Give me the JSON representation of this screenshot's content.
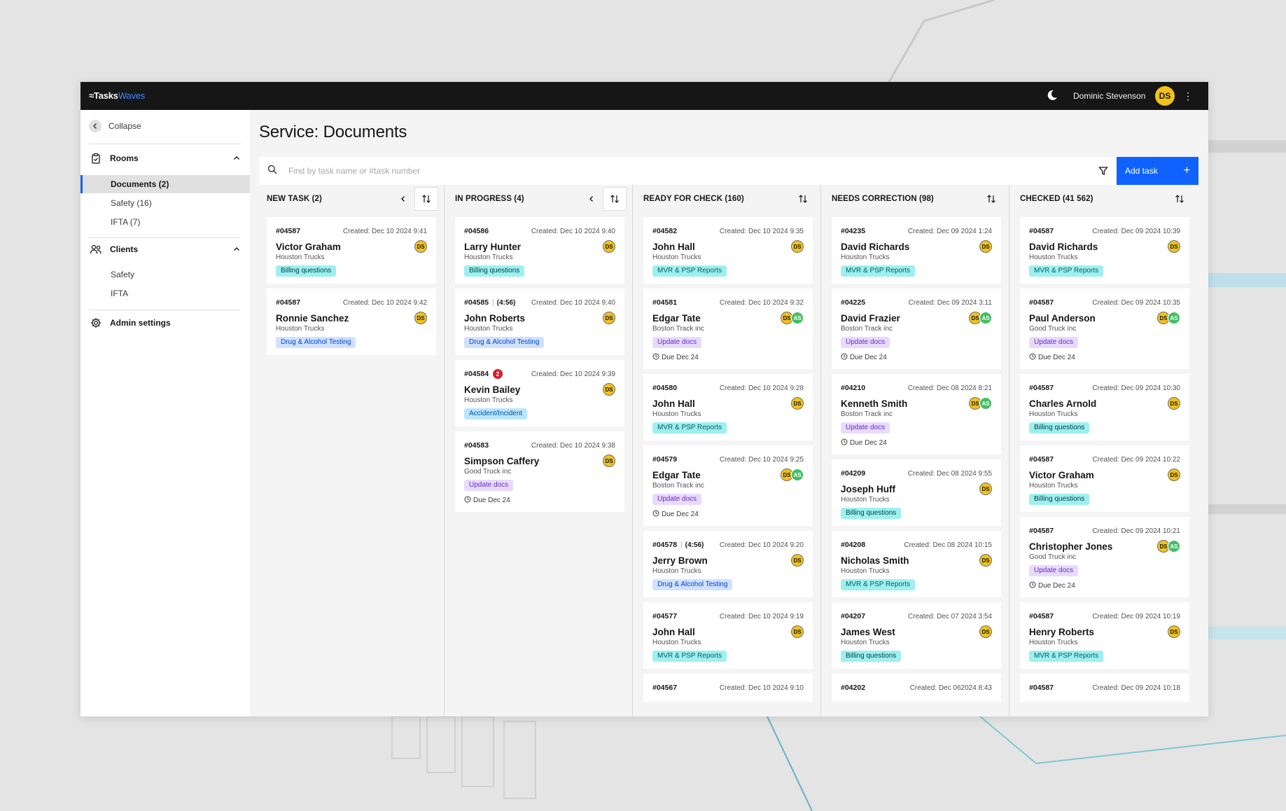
{
  "app": {
    "logo_main": "≈Tasks",
    "logo_accent": "Waves",
    "user_name": "Dominic Stevenson",
    "user_initials": "DS",
    "menu_glyph": "⋮"
  },
  "sidebar": {
    "collapse_label": "Collapse",
    "rooms": {
      "title": "Rooms",
      "items": [
        {
          "label": "Documents (2)",
          "active": true
        },
        {
          "label": "Safety (16)",
          "active": false
        },
        {
          "label": "IFTA (7)",
          "active": false
        }
      ]
    },
    "clients": {
      "title": "Clients",
      "items": [
        {
          "label": "Safety"
        },
        {
          "label": "IFTA"
        }
      ]
    },
    "admin_label": "Admin settings"
  },
  "main": {
    "title": "Service: Documents",
    "search_placeholder": "Find by task name or #task number",
    "add_task_label": "Add task",
    "add_task_plus": "+"
  },
  "colors": {
    "accent": "#0f62fe",
    "topbar": "#161616",
    "avatar_yellow": "#f1c21b",
    "avatar_green": "#42be65",
    "badge_red": "#da1e28"
  },
  "columns": [
    {
      "title": "NEW TASK (2)",
      "collapsible": true,
      "sort_boxed": true,
      "cards": [
        {
          "id": "#04587",
          "created": "Created: Dec 10 2024 9:41",
          "name": "Victor Graham",
          "company": "Houston Trucks",
          "tag": "Billing questions",
          "tag_type": "billing",
          "avatars": [
            "DS"
          ]
        },
        {
          "id": "#04587",
          "created": "Created: Dec 10 2024 9:42",
          "name": "Ronnie Sanchez",
          "company": "Houston Trucks",
          "tag": "Drug & Alcohol Testing",
          "tag_type": "drug",
          "avatars": [
            "DS"
          ]
        }
      ]
    },
    {
      "title": "IN PROGRESS (4)",
      "collapsible": true,
      "sort_boxed": true,
      "cards": [
        {
          "id": "#04586",
          "created": "Created: Dec 10 2024 9:40",
          "name": "Larry Hunter",
          "company": "Houston Trucks",
          "tag": "Billing questions",
          "tag_type": "billing",
          "avatars": [
            "DS"
          ]
        },
        {
          "id": "#04585",
          "duration": "(4:56)",
          "created": "Created: Dec 10 2024 9:40",
          "name": "John Roberts",
          "company": "Houston Trucks",
          "tag": "Drug & Alcohol Testing",
          "tag_type": "drug",
          "avatars": [
            "DS"
          ]
        },
        {
          "id": "#04584",
          "badge": "2",
          "created": "Created: Dec 10 2024 9:39",
          "name": "Kevin Bailey",
          "company": "Houston Trucks",
          "tag": "Accident/Incident",
          "tag_type": "accident",
          "avatars": [
            "DS"
          ]
        },
        {
          "id": "#04583",
          "created": "Created: Dec 10 2024 9:38",
          "name": "Simpson Caffery",
          "company": "Good Truck inc",
          "tag": "Update docs",
          "tag_type": "update",
          "due": "Due Dec 24",
          "avatars": [
            "DS"
          ]
        }
      ]
    },
    {
      "title": "READY FOR CHECK (160)",
      "collapsible": false,
      "sort_boxed": false,
      "cards": [
        {
          "id": "#04582",
          "created": "Created: Dec 10 2024 9:35",
          "name": "John Hall",
          "company": "Houston Trucks",
          "tag": "MVR & PSP Reports",
          "tag_type": "mvr",
          "avatars": [
            "DS"
          ]
        },
        {
          "id": "#04581",
          "created": "Created: Dec 10 2024 9:32",
          "name": "Edgar Tate",
          "company": "Boston Track inc",
          "tag": "Update docs",
          "tag_type": "update",
          "due": "Due Dec 24",
          "avatars": [
            "DS",
            "AS"
          ]
        },
        {
          "id": "#04580",
          "created": "Created: Dec 10 2024 9:28",
          "name": "John Hall",
          "company": "Houston Trucks",
          "tag": "MVR & PSP Reports",
          "tag_type": "mvr",
          "avatars": [
            "DS"
          ]
        },
        {
          "id": "#04579",
          "created": "Created: Dec 10 2024 9:25",
          "name": "Edgar Tate",
          "company": "Boston Track inc",
          "tag": "Update docs",
          "tag_type": "update",
          "due": "Due Dec 24",
          "avatars": [
            "DS",
            "AS"
          ]
        },
        {
          "id": "#04578",
          "duration": "(4:56)",
          "created": "Created: Dec 10 2024 9:20",
          "name": "Jerry Brown",
          "company": "Houston Trucks",
          "tag": "Drug & Alcohol Testing",
          "tag_type": "drug",
          "avatars": [
            "DS"
          ]
        },
        {
          "id": "#04577",
          "created": "Created: Dec 10 2024 9:19",
          "name": "John Hall",
          "company": "Houston Trucks",
          "tag": "MVR & PSP Reports",
          "tag_type": "mvr",
          "avatars": [
            "DS"
          ]
        },
        {
          "id": "#04567",
          "created": "Created: Dec 10 2024 9:10",
          "name": "",
          "company": "",
          "tag": "",
          "tag_type": "",
          "avatars": []
        }
      ]
    },
    {
      "title": "NEEDS CORRECTION (98)",
      "collapsible": false,
      "sort_boxed": false,
      "cards": [
        {
          "id": "#04235",
          "created": "Created: Dec 09 2024 1:24",
          "name": "David Richards",
          "company": "Houston Trucks",
          "tag": "MVR & PSP Reports",
          "tag_type": "mvr",
          "avatars": [
            "DS"
          ]
        },
        {
          "id": "#04225",
          "created": "Created: Dec 09 2024 3:11",
          "name": "David Frazier",
          "company": "Boston Track inc",
          "tag": "Update docs",
          "tag_type": "update",
          "due": "Due Dec 24",
          "avatars": [
            "DS",
            "AS"
          ]
        },
        {
          "id": "#04210",
          "created": "Created: Dec 08 2024 8:21",
          "name": "Kenneth Smith",
          "company": "Boston Track inc",
          "tag": "Update docs",
          "tag_type": "update",
          "due": "Due Dec 24",
          "avatars": [
            "DS",
            "AS"
          ]
        },
        {
          "id": "#04209",
          "created": "Created: Dec 08 2024 9:55",
          "name": "Joseph Huff",
          "company": "Houston Trucks",
          "tag": "Billing questions",
          "tag_type": "billing",
          "avatars": [
            "DS"
          ]
        },
        {
          "id": "#04208",
          "created": "Created: Dec 08 2024 10:15",
          "name": "Nicholas Smith",
          "company": "Houston Trucks",
          "tag": "MVR & PSP Reports",
          "tag_type": "mvr",
          "avatars": [
            "DS"
          ]
        },
        {
          "id": "#04207",
          "created": "Created: Dec 07 2024 3:54",
          "name": "James West",
          "company": "Houston Trucks",
          "tag": "Billing questions",
          "tag_type": "billing",
          "avatars": [
            "DS"
          ]
        },
        {
          "id": "#04202",
          "created": "Created: Dec 062024 8:43",
          "name": "",
          "company": "",
          "tag": "",
          "tag_type": "",
          "avatars": []
        }
      ]
    },
    {
      "title": "CHECKED (41 562)",
      "collapsible": false,
      "sort_boxed": false,
      "cards": [
        {
          "id": "#04587",
          "created": "Created: Dec 09 2024 10:39",
          "name": "David Richards",
          "company": "Houston Trucks",
          "tag": "MVR & PSP Reports",
          "tag_type": "mvr",
          "avatars": [
            "DS"
          ]
        },
        {
          "id": "#04587",
          "created": "Created: Dec 09 2024 10:35",
          "name": "Paul Anderson",
          "company": "Good Truck inc",
          "tag": "Update docs",
          "tag_type": "update",
          "due": "Due Dec 24",
          "avatars": [
            "DS",
            "AS"
          ]
        },
        {
          "id": "#04587",
          "created": "Created: Dec 09 2024 10:30",
          "name": "Charles Arnold",
          "company": "Houston Trucks",
          "tag": "Billing questions",
          "tag_type": "billing",
          "avatars": [
            "DS"
          ]
        },
        {
          "id": "#04587",
          "created": "Created: Dec 09 2024 10:22",
          "name": "Victor Graham",
          "company": "Houston Trucks",
          "tag": "Billing questions",
          "tag_type": "billing",
          "avatars": [
            "DS"
          ]
        },
        {
          "id": "#04587",
          "created": "Created: Dec 09 2024 10:21",
          "name": "Christopher Jones",
          "company": "Good Truck inc",
          "tag": "Update docs",
          "tag_type": "update",
          "due": "Due Dec 24",
          "avatars": [
            "DS",
            "AS"
          ]
        },
        {
          "id": "#04587",
          "created": "Created: Dec 09 2024 10:19",
          "name": "Henry Roberts",
          "company": "Houston Trucks",
          "tag": "MVR & PSP Reports",
          "tag_type": "mvr",
          "avatars": [
            "DS"
          ]
        },
        {
          "id": "#04587",
          "created": "Created: Dec 09 2024 10:18",
          "name": "",
          "company": "",
          "tag": "",
          "tag_type": "",
          "avatars": []
        }
      ]
    }
  ]
}
